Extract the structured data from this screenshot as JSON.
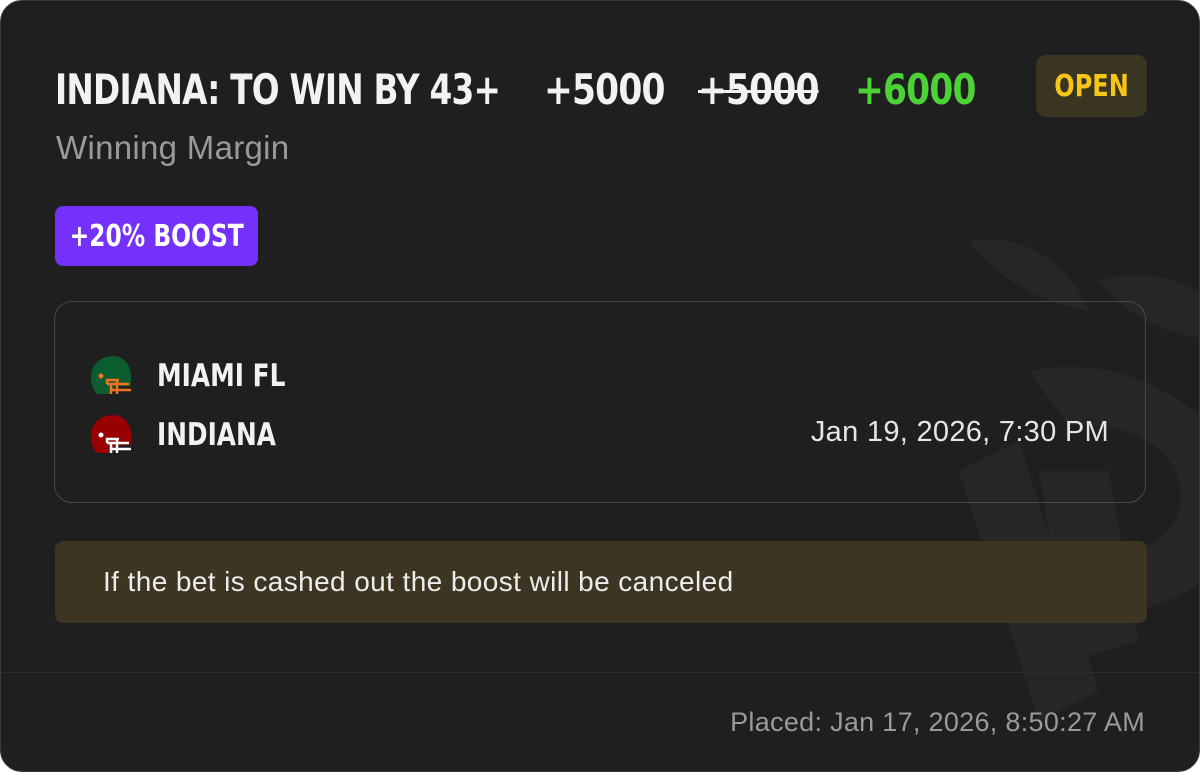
{
  "bet": {
    "title": "INDIANA: TO WIN BY 43+",
    "odds_current": "+5000",
    "odds_original": "+5000",
    "odds_boosted": "+6000",
    "status": "OPEN",
    "market": "Winning Margin",
    "boost_label": "+20% BOOST"
  },
  "matchup": {
    "teams": [
      {
        "name": "MIAMI FL",
        "icon": "football-helmet-icon",
        "color": "#0b5c2e",
        "facemask": "#f47321"
      },
      {
        "name": "INDIANA",
        "icon": "football-helmet-icon",
        "color": "#990000",
        "facemask": "#ffffff"
      }
    ],
    "game_time": "Jan 19, 2026, 7:30 PM"
  },
  "notice": "If the bet is cashed out the boost will be canceled",
  "placed": "Placed: Jan 17, 2026, 8:50:27 AM",
  "colors": {
    "card_bg": "#1f1f20",
    "boosted_odds": "#4cd137",
    "status_text": "#f5c518",
    "boost_badge": "#7431f9"
  }
}
